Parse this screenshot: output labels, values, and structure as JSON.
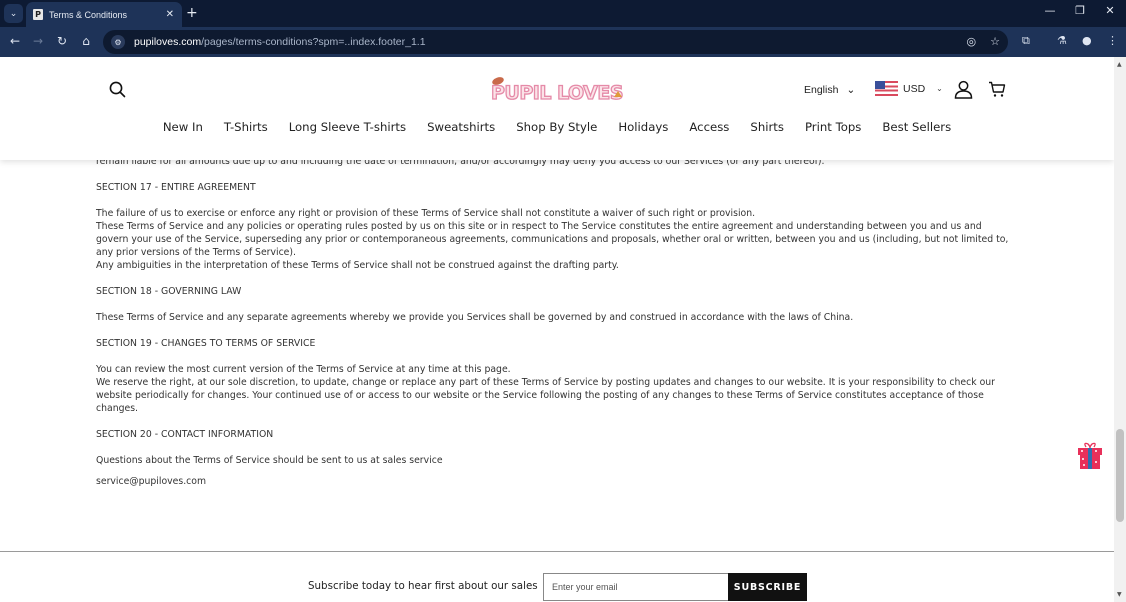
{
  "browser": {
    "tab_title": "Terms & Conditions",
    "tab_favicon": "P",
    "url_domain": "pupiloves.com",
    "url_path": "/pages/terms-conditions?spm=..index.footer_1.1",
    "icons": {
      "tab_list": "chevron-down-icon",
      "close_tab": "close-icon",
      "new_tab": "plus-icon",
      "back": "arrow-left-icon",
      "forward": "arrow-right-icon",
      "reload": "reload-icon",
      "home": "home-icon",
      "site_info": "tune-icon",
      "tracking": "eye-off-icon",
      "bookmark": "star-icon",
      "extensions": "puzzle-icon",
      "labs": "flask-icon",
      "profile": "profile-icon",
      "menu": "kebab-menu-icon"
    },
    "glyphs": {
      "tab_list": "⌄",
      "close_tab": "✕",
      "new_tab": "+",
      "minimize": "—",
      "restore": "❐",
      "close_window": "✕",
      "back": "←",
      "forward": "→",
      "reload": "↻",
      "home": "⌂",
      "site_info": "⚙",
      "tracking": "◎",
      "bookmark": "☆",
      "extensions": "⧉",
      "labs": "⚗",
      "profile": "●",
      "menu": "⋮"
    }
  },
  "header": {
    "logo_text": "PUPIL LOVES",
    "language": "English",
    "currency": "USD",
    "chevron": "⌄",
    "nav": [
      "New In",
      "T-Shirts",
      "Long Sleeve T-shirts",
      "Sweatshirts",
      "Shop By Style",
      "Holidays",
      "Access",
      "Shirts",
      "Print Tops",
      "Best Sellers"
    ]
  },
  "content": {
    "partial_line": "remain liable for all amounts due up to and including the date of termination; and/or accordingly may deny you access to our Services (or any part thereof).",
    "s17_title": "SECTION 17 - ENTIRE AGREEMENT",
    "s17_p1": "The failure of us to exercise or enforce any right or provision of these Terms of Service shall not constitute a waiver of such right or provision.",
    "s17_p2": "These Terms of Service and any policies or operating rules posted by us on this site or in respect to The Service constitutes the entire agreement and understanding between you and us and govern your use of the Service, superseding any prior or contemporaneous agreements, communications and proposals, whether oral or written, between you and us (including, but not limited to, any prior versions of the Terms of Service).",
    "s17_p3": "Any ambiguities in the interpretation of these Terms of Service shall not be construed against the drafting party.",
    "s18_title": "SECTION 18 - GOVERNING LAW",
    "s18_p1": "These Terms of Service and any separate agreements whereby we provide you Services shall be governed by and construed in accordance with the laws of China.",
    "s19_title": "SECTION 19 - CHANGES TO TERMS OF SERVICE",
    "s19_p1": "You can review the most current version of the Terms of Service at any time at this page.",
    "s19_p2": "We reserve the right, at our sole discretion, to update, change or replace any part of these Terms of Service by posting updates and changes to our website. It is your responsibility to check our website periodically for changes. Your continued use of or access to our website or the Service following the posting of any changes to these Terms of Service constitutes acceptance of those changes.",
    "s20_title": "SECTION 20 - CONTACT INFORMATION",
    "s20_p1": "Questions about the Terms of Service should be sent to us at sales service",
    "s20_email": "service@pupiloves.com"
  },
  "footer": {
    "subscribe_text": "Subscribe today to hear first about our sales",
    "email_placeholder": "Enter your email",
    "subscribe_label": "SUBSCRIBE"
  },
  "colors": {
    "browser_frame": "#0d1a33",
    "browser_toolbar": "#1e3358",
    "text": "#333333",
    "button_bg": "#111111",
    "gift_red": "#e8305a",
    "gift_ribbon": "#2f6fb0"
  }
}
